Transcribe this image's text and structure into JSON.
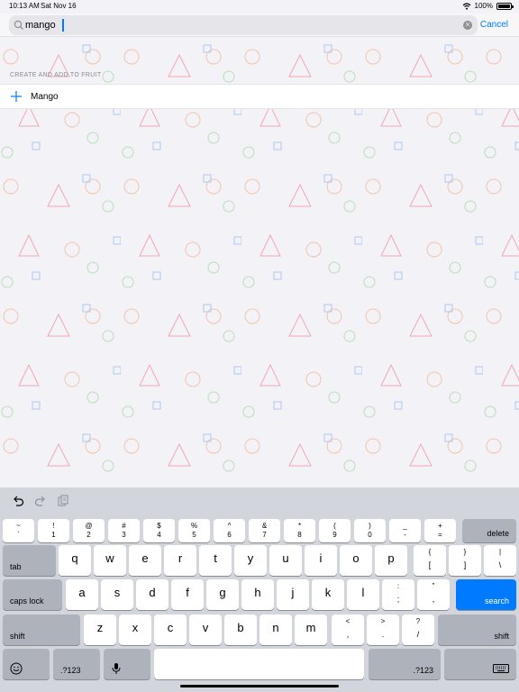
{
  "status_bar": {
    "time": "10:13 AM",
    "date": "Sat Nov 16",
    "battery": "100%"
  },
  "search": {
    "query": "mango",
    "cancel_label": "Cancel"
  },
  "results": {
    "section_header": "CREATE AND ADD TO FRUIT",
    "items": [
      {
        "label": "Mango"
      }
    ]
  },
  "keyboard": {
    "number_row": [
      {
        "top": "~",
        "bottom": "`"
      },
      {
        "top": "!",
        "bottom": "1"
      },
      {
        "top": "@",
        "bottom": "2"
      },
      {
        "top": "#",
        "bottom": "3"
      },
      {
        "top": "$",
        "bottom": "4"
      },
      {
        "top": "%",
        "bottom": "5"
      },
      {
        "top": "^",
        "bottom": "6"
      },
      {
        "top": "&",
        "bottom": "7"
      },
      {
        "top": "*",
        "bottom": "8"
      },
      {
        "top": "(",
        "bottom": "9"
      },
      {
        "top": ")",
        "bottom": "0"
      },
      {
        "top": "_",
        "bottom": "-"
      },
      {
        "top": "+",
        "bottom": "="
      }
    ],
    "delete_label": "delete",
    "tab_label": "tab",
    "row_q": [
      "q",
      "w",
      "e",
      "r",
      "t",
      "y",
      "u",
      "i",
      "o",
      "p"
    ],
    "row_q_extra": [
      {
        "top": "{",
        "bottom": "["
      },
      {
        "top": "}",
        "bottom": "]"
      },
      {
        "top": "|",
        "bottom": "\\"
      }
    ],
    "caps_label": "caps lock",
    "row_a": [
      "a",
      "s",
      "d",
      "f",
      "g",
      "h",
      "j",
      "k",
      "l"
    ],
    "row_a_extra": [
      {
        "top": ":",
        "bottom": ";"
      },
      {
        "top": "\"",
        "bottom": ","
      }
    ],
    "search_label": "search",
    "shift_label": "shift",
    "row_z": [
      "z",
      "x",
      "c",
      "v",
      "b",
      "n",
      "m"
    ],
    "row_z_extra": [
      {
        "top": "<",
        "bottom": ","
      },
      {
        "top": ">",
        "bottom": "."
      },
      {
        "top": "?",
        "bottom": "/"
      }
    ],
    "num_toggle_label": ".?123"
  },
  "colors": {
    "accent": "#007aff",
    "pattern_red": "#f4a6b4",
    "pattern_orange": "#f6c3ad",
    "pattern_green": "#b8dfb9",
    "pattern_blue": "#aec8f2"
  }
}
